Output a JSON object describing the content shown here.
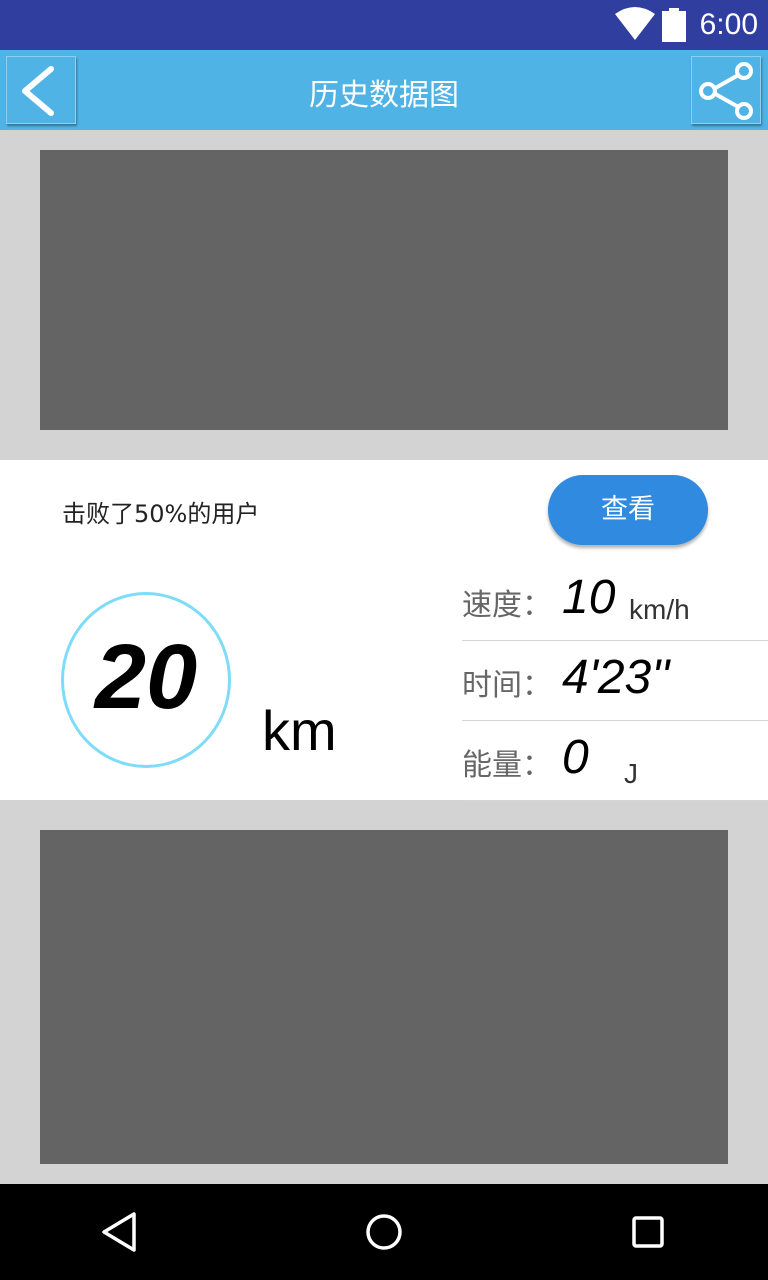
{
  "status_bar": {
    "time": "6:00",
    "icons": [
      "wifi-icon",
      "battery-icon"
    ]
  },
  "app_bar": {
    "title": "历史数据图",
    "back_icon": "chevron-left-icon",
    "share_icon": "share-icon"
  },
  "summary": {
    "beat_text": "击败了50%的用户",
    "view_button_label": "查看",
    "distance_value": "20",
    "distance_unit": "km"
  },
  "stats": [
    {
      "label": "速度：",
      "value": "10",
      "unit": "km/h"
    },
    {
      "label": "时间：",
      "value": "4'23''",
      "unit": ""
    },
    {
      "label": "能量：",
      "value": "0",
      "unit": "J"
    }
  ],
  "colors": {
    "status_bar": "#303f9f",
    "app_bar": "#4fb3e6",
    "button": "#2f8ae0",
    "circle": "#7fdcf8",
    "placeholder": "#646464",
    "background": "#d3d3d3"
  },
  "nav_bar": {
    "icons": [
      "back-triangle-icon",
      "home-circle-icon",
      "recents-square-icon"
    ]
  }
}
